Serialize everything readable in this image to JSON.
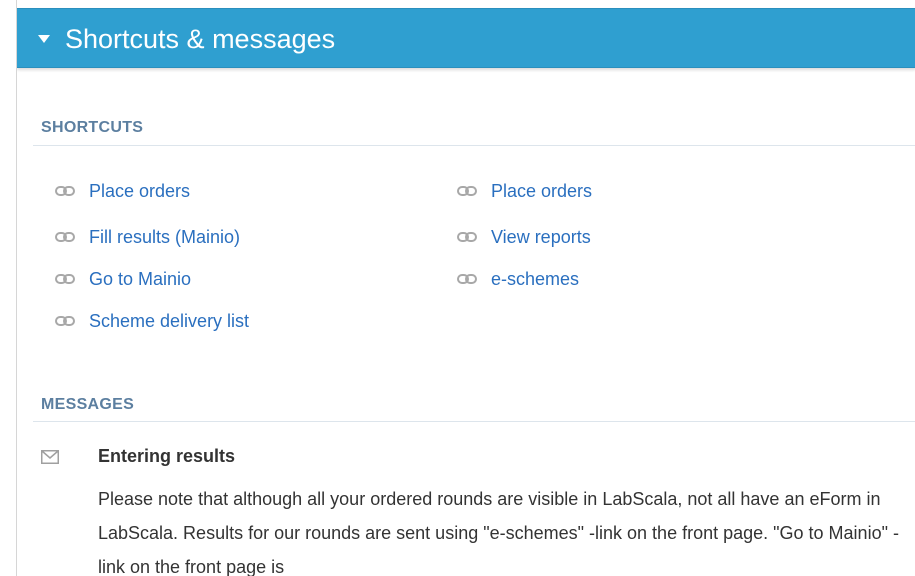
{
  "header": {
    "title": "Shortcuts & messages"
  },
  "shortcuts": {
    "heading": "SHORTCUTS",
    "left": [
      {
        "label": "Place orders"
      },
      {
        "label": "Fill results (Mainio)"
      },
      {
        "label": "Go to Mainio"
      },
      {
        "label": "Scheme delivery list"
      }
    ],
    "right": [
      {
        "label": "Place orders"
      },
      {
        "label": "View reports"
      },
      {
        "label": "e-schemes"
      }
    ]
  },
  "messages": {
    "heading": "MESSAGES",
    "items": [
      {
        "title": "Entering results",
        "body": "Please note that although all your ordered rounds are visible in LabScala, not all have an eForm in LabScala. Results for our rounds are sent using \"e-schemes\" -link on the front page. \"Go to Mainio\" -link on the front page is"
      }
    ]
  },
  "colors": {
    "header_bg": "#2f9fd0",
    "link": "#2a6fbf",
    "section_heading": "#5c7fa0"
  }
}
